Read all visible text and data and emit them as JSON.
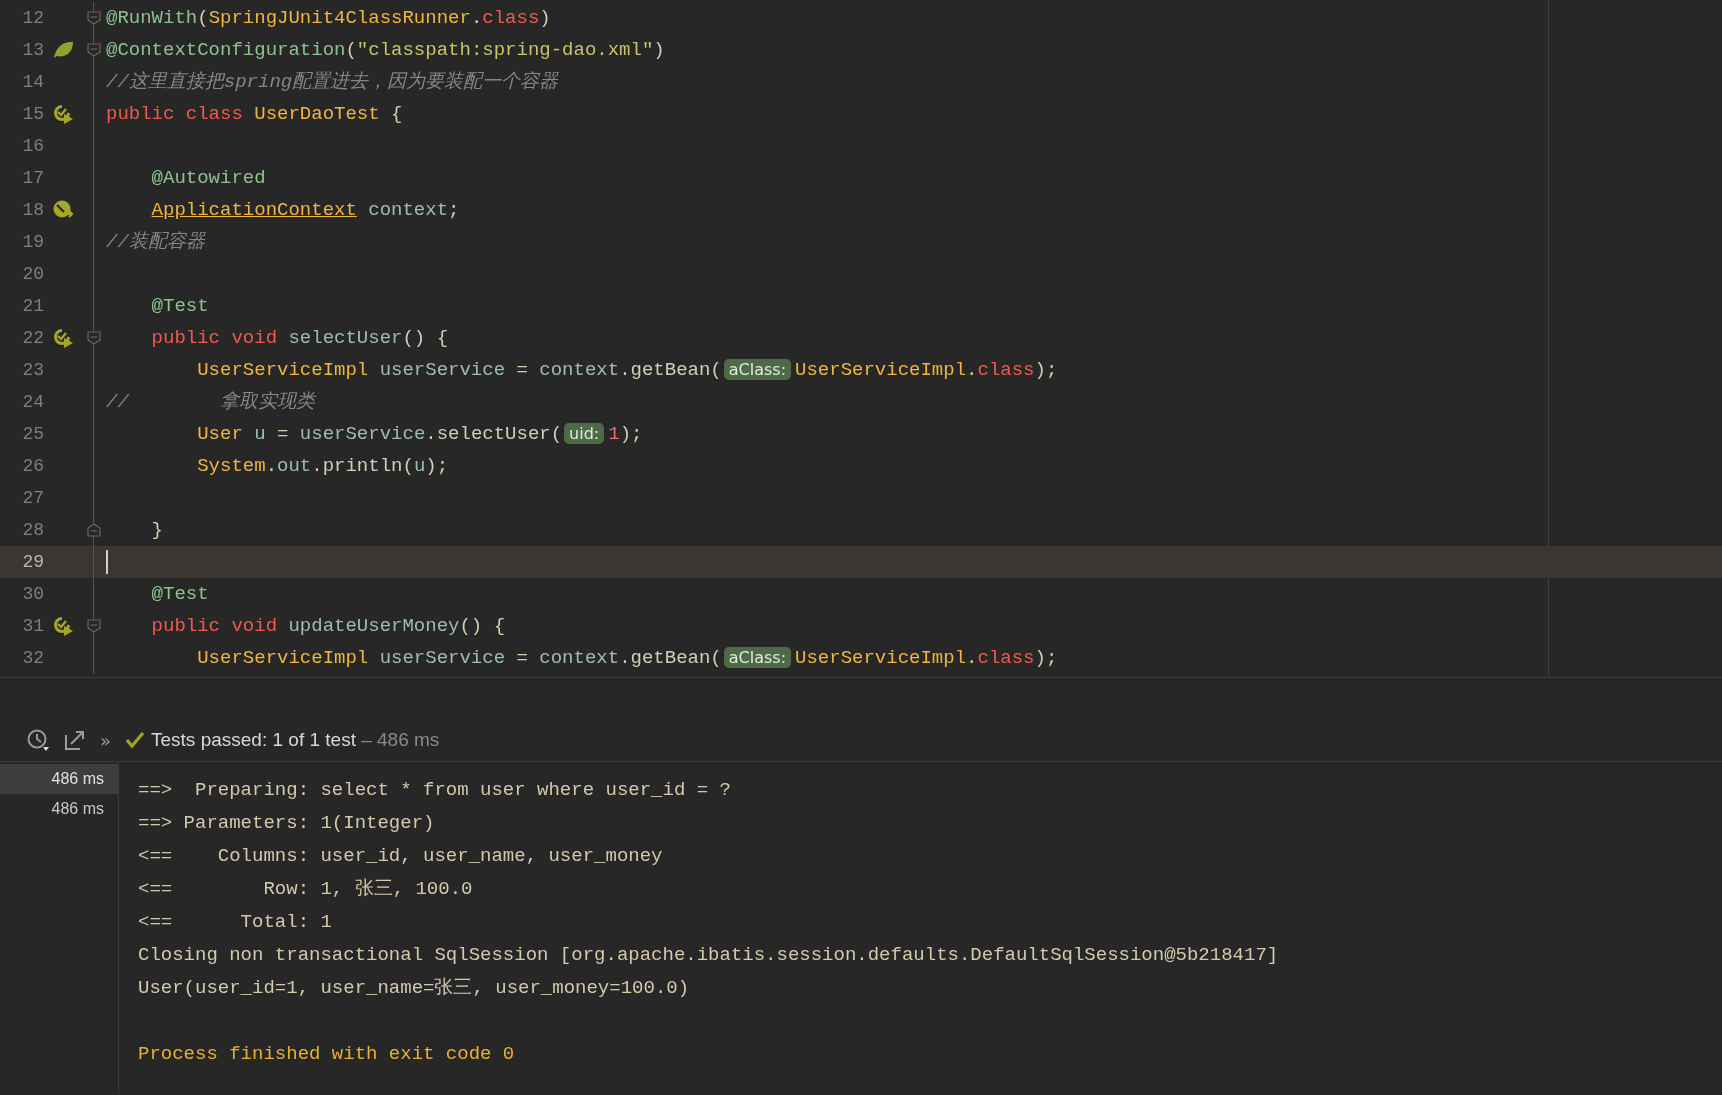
{
  "editor": {
    "lines": [
      {
        "number": "12",
        "current": false,
        "fold_marker": {
          "kind": "start"
        },
        "tokens": [
          {
            "kind": "annotation",
            "text": "@RunWith"
          },
          {
            "kind": "plain",
            "text": "("
          },
          {
            "kind": "class",
            "text": "SpringJUnit4ClassRunner"
          },
          {
            "kind": "plain",
            "text": "."
          },
          {
            "kind": "keyword",
            "text": "class"
          },
          {
            "kind": "plain",
            "text": ")"
          }
        ]
      },
      {
        "number": "13",
        "current": false,
        "gutter_icon": {
          "kind": "leaf"
        },
        "fold_marker": {
          "kind": "start"
        },
        "tokens": [
          {
            "kind": "annotation",
            "text": "@ContextConfiguration"
          },
          {
            "kind": "plain",
            "text": "("
          },
          {
            "kind": "string",
            "text": "\"classpath:spring-dao.xml\""
          },
          {
            "kind": "plain",
            "text": ")"
          }
        ]
      },
      {
        "number": "14",
        "current": false,
        "tokens": [
          {
            "kind": "comment",
            "text": "//这里直接把spring配置进去，因为要装配一个容器"
          }
        ]
      },
      {
        "number": "15",
        "current": false,
        "gutter_icon": {
          "kind": "run"
        },
        "tokens": [
          {
            "kind": "keyword",
            "text": "public class "
          },
          {
            "kind": "class",
            "text": "UserDaoTest"
          },
          {
            "kind": "plain",
            "text": " {"
          }
        ]
      },
      {
        "number": "16",
        "current": false
      },
      {
        "number": "17",
        "current": false,
        "tokens": [
          {
            "kind": "annotation",
            "text": "    @Autowired"
          }
        ]
      },
      {
        "number": "18",
        "current": false,
        "gutter_icon": {
          "kind": "bean"
        },
        "tokens": [
          {
            "kind": "class_link",
            "text": "    ApplicationContext"
          },
          {
            "kind": "field",
            "text": " context"
          },
          {
            "kind": "plain",
            "text": ";"
          }
        ]
      },
      {
        "number": "19",
        "current": false,
        "tokens": [
          {
            "kind": "comment",
            "text": "//装配容器"
          }
        ]
      },
      {
        "number": "20",
        "current": false
      },
      {
        "number": "21",
        "current": false,
        "tokens": [
          {
            "kind": "annotation",
            "text": "    @Test"
          }
        ]
      },
      {
        "number": "22",
        "current": false,
        "gutter_icon": {
          "kind": "run"
        },
        "fold_marker": {
          "kind": "start"
        },
        "tokens": [
          {
            "kind": "keyword",
            "text": "    public void "
          },
          {
            "kind": "field",
            "text": "selectUser"
          },
          {
            "kind": "plain",
            "text": "() {"
          }
        ]
      },
      {
        "number": "23",
        "current": false,
        "tokens": [
          {
            "kind": "class",
            "text": "        UserServiceImpl"
          },
          {
            "kind": "field",
            "text": " userService"
          },
          {
            "kind": "plain",
            "text": " = "
          },
          {
            "kind": "field",
            "text": "context"
          },
          {
            "kind": "plain",
            "text": ".getBean("
          },
          {
            "kind": "hint",
            "text": "aClass:"
          },
          {
            "kind": "class",
            "text": "UserServiceImpl"
          },
          {
            "kind": "plain",
            "text": "."
          },
          {
            "kind": "keyword",
            "text": "class"
          },
          {
            "kind": "plain",
            "text": ");"
          }
        ]
      },
      {
        "number": "24",
        "current": false,
        "tokens": [
          {
            "kind": "comment",
            "text": "//        拿取实现类"
          }
        ]
      },
      {
        "number": "25",
        "current": false,
        "tokens": [
          {
            "kind": "class",
            "text": "        User"
          },
          {
            "kind": "field",
            "text": " u"
          },
          {
            "kind": "plain",
            "text": " = "
          },
          {
            "kind": "field",
            "text": "userService"
          },
          {
            "kind": "plain",
            "text": ".selectUser("
          },
          {
            "kind": "hint",
            "text": "uid:"
          },
          {
            "kind": "number",
            "text": "1"
          },
          {
            "kind": "plain",
            "text": ");"
          }
        ]
      },
      {
        "number": "26",
        "current": false,
        "tokens": [
          {
            "kind": "class",
            "text": "        System"
          },
          {
            "kind": "plain",
            "text": "."
          },
          {
            "kind": "field",
            "text": "out"
          },
          {
            "kind": "plain",
            "text": ".println("
          },
          {
            "kind": "field",
            "text": "u"
          },
          {
            "kind": "plain",
            "text": ");"
          }
        ]
      },
      {
        "number": "27",
        "current": false
      },
      {
        "number": "28",
        "current": false,
        "fold_marker": {
          "kind": "end"
        },
        "tokens": [
          {
            "kind": "plain",
            "text": "    }"
          }
        ]
      },
      {
        "number": "29",
        "current": true
      },
      {
        "number": "30",
        "current": false,
        "tokens": [
          {
            "kind": "annotation",
            "text": "    @Test"
          }
        ]
      },
      {
        "number": "31",
        "current": false,
        "gutter_icon": {
          "kind": "run"
        },
        "fold_marker": {
          "kind": "start"
        },
        "tokens": [
          {
            "kind": "keyword",
            "text": "    public void "
          },
          {
            "kind": "field",
            "text": "updateUserMoney"
          },
          {
            "kind": "plain",
            "text": "() {"
          }
        ]
      },
      {
        "number": "32",
        "current": false,
        "tokens": [
          {
            "kind": "class",
            "text": "        UserServiceImpl"
          },
          {
            "kind": "field",
            "text": " userService"
          },
          {
            "kind": "plain",
            "text": " = "
          },
          {
            "kind": "field",
            "text": "context"
          },
          {
            "kind": "plain",
            "text": ".getBean("
          },
          {
            "kind": "hint",
            "text": "aClass:"
          },
          {
            "kind": "class",
            "text": "UserServiceImpl"
          },
          {
            "kind": "plain",
            "text": "."
          },
          {
            "kind": "keyword",
            "text": "class"
          },
          {
            "kind": "plain",
            "text": ");"
          }
        ]
      }
    ]
  },
  "test_panel": {
    "more": "»",
    "status": "Tests passed: 1 of 1 test",
    "duration": "– 486 ms",
    "tests": [
      {
        "duration": "486 ms",
        "selected": true
      },
      {
        "duration": "486 ms",
        "selected": false
      }
    ],
    "console": [
      {
        "kind": "output",
        "text": "==>  Preparing: select * from user where user_id = ?"
      },
      {
        "kind": "output",
        "text": "==> Parameters: 1(Integer)"
      },
      {
        "kind": "output",
        "text": "<==    Columns: user_id, user_name, user_money"
      },
      {
        "kind": "output",
        "text": "<==        Row: 1, 张三, 100.0"
      },
      {
        "kind": "output",
        "text": "<==      Total: 1"
      },
      {
        "kind": "output",
        "text": "Closing non transactional SqlSession [org.apache.ibatis.session.defaults.DefaultSqlSession@5b218417]"
      },
      {
        "kind": "output",
        "text": "User(user_id=1, user_name=张三, user_money=100.0)"
      },
      {
        "kind": "blank"
      },
      {
        "kind": "exit",
        "text": "Process finished with exit code 0"
      }
    ]
  }
}
